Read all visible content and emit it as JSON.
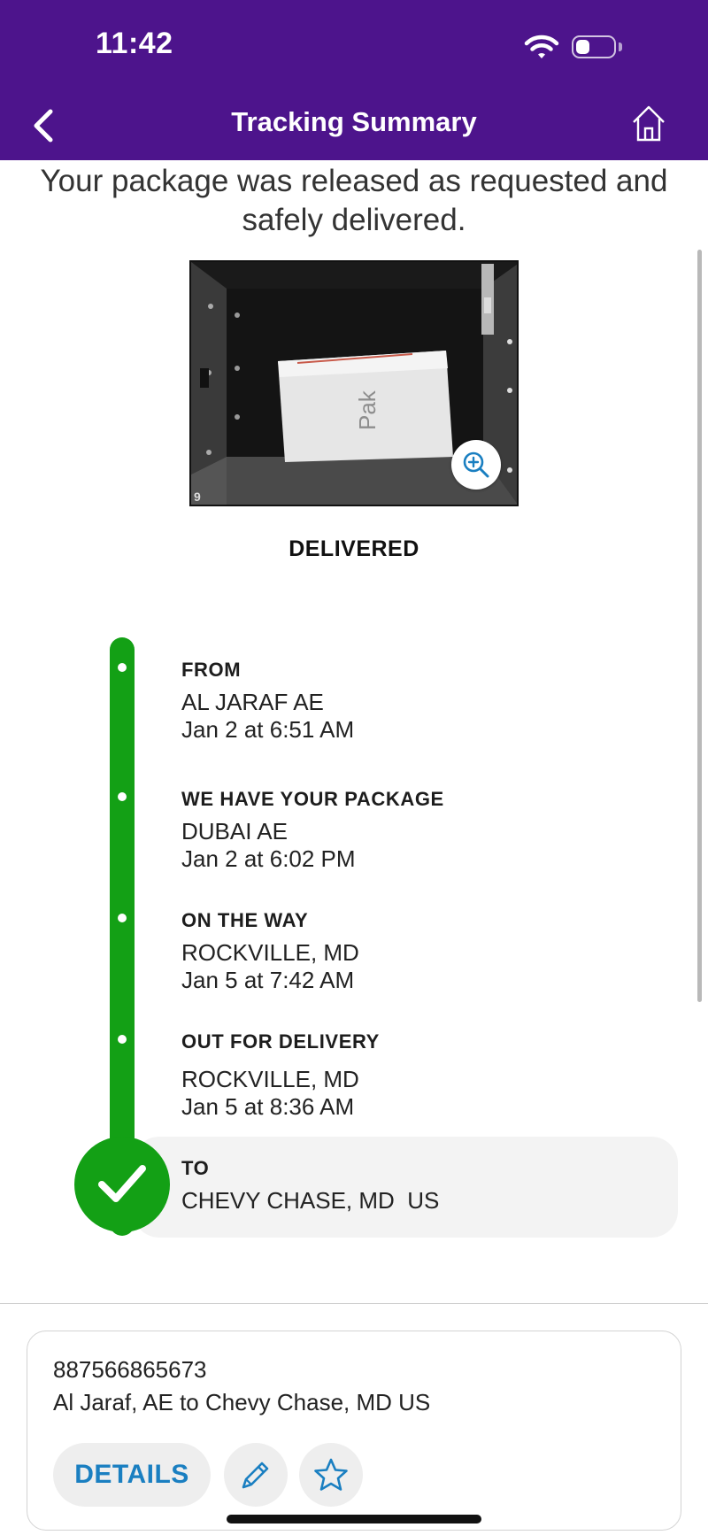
{
  "status_bar": {
    "time": "11:42"
  },
  "header": {
    "title": "Tracking Summary",
    "back_icon": "chevron-left-icon",
    "home_icon": "home-icon"
  },
  "message": "Your package was released as requested and safely delivered.",
  "photo": {
    "package_label": "Pak",
    "zoom_icon": "zoom-in-icon"
  },
  "status": "DELIVERED",
  "timeline": [
    {
      "title": "FROM",
      "location": "AL JARAF AE",
      "time": "Jan 2 at 6:51 AM"
    },
    {
      "title": "WE HAVE YOUR PACKAGE",
      "location": "DUBAI AE",
      "time": "Jan 2 at 6:02 PM"
    },
    {
      "title": "ON THE WAY",
      "location": "ROCKVILLE, MD",
      "time": "Jan 5 at 7:42 AM"
    },
    {
      "title": "OUT FOR DELIVERY",
      "location": "ROCKVILLE, MD",
      "time": "Jan 5 at 8:36 AM"
    },
    {
      "title": "TO",
      "location": "CHEVY CHASE, MD  US"
    }
  ],
  "shipment": {
    "tracking_number": "887566865673",
    "route": "Al Jaraf, AE to Chevy Chase, MD US",
    "details_label": "DETAILS",
    "edit_icon": "pencil-icon",
    "favorite_icon": "star-icon"
  },
  "colors": {
    "header": "#4d148c",
    "timeline": "#13a015",
    "accent": "#1a7fc1"
  }
}
